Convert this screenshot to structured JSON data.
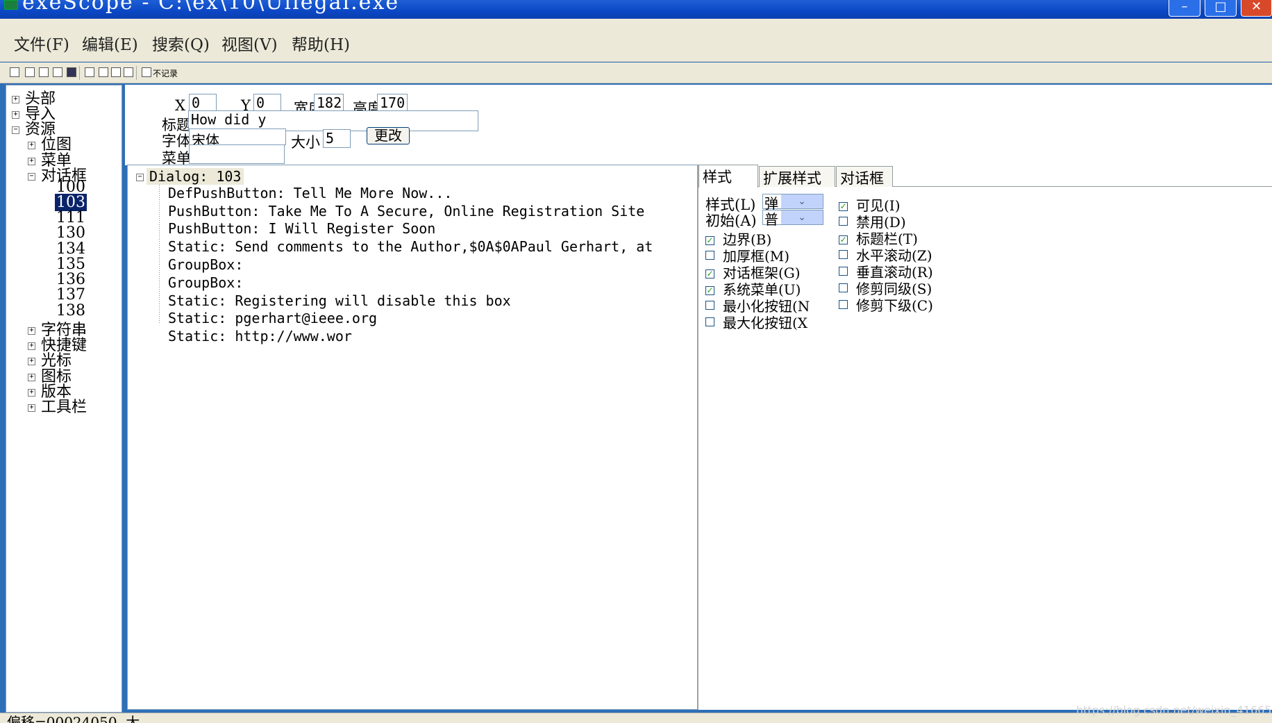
{
  "window": {
    "title": "exeScope - C:\\ex\\10\\Ullegal.exe",
    "minimize": "–",
    "maximize": "□",
    "close": "✕"
  },
  "menu": {
    "items": [
      "文件(F)",
      "编辑(E)",
      "搜索(Q)",
      "视图(V)",
      "帮助(H)"
    ]
  },
  "toolbar": {
    "no_record_label": "不记录"
  },
  "tree": {
    "header": "头部",
    "import": "导入",
    "resources": "资源",
    "bitmap": "位图",
    "menu": "菜单",
    "dialog": "对话框",
    "dialog_ids": [
      "100",
      "103",
      "111",
      "130",
      "134",
      "135",
      "136",
      "137",
      "138"
    ],
    "string": "字符串",
    "accelerator": "快捷键",
    "cursor": "光标",
    "icon": "图标",
    "version": "版本",
    "toolbar": "工具栏"
  },
  "props": {
    "x_label": "X",
    "x_value": "0",
    "y_label": "Y",
    "y_value": "0",
    "width_label": "宽度",
    "width_value": "182",
    "height_label": "高度",
    "height_value": "170",
    "title_label": "标题",
    "title_value": "How did y",
    "font_label": "字体",
    "font_value": "宋体",
    "size_label": "大小",
    "size_value": "5",
    "menu_label": "菜单",
    "menu_value": "",
    "change_button": "更改"
  },
  "dialog_tree": {
    "root": "Dialog: 103",
    "items": [
      "DefPushButton: Tell Me More Now...",
      "PushButton: Take Me To A Secure, Online Registration Site",
      "PushButton: I Will Register Soon",
      "Static: Send comments to the Author,$0A$0APaul Gerhart, at",
      "GroupBox:",
      "GroupBox:",
      "Static: Registering will disable this box",
      "Static: pgerhart@ieee.org",
      "Static: http://www.wor"
    ]
  },
  "style_panel": {
    "tabs": [
      "样式",
      "扩展样式",
      "对话框"
    ],
    "style_label": "样式(L)",
    "style_value": "弹",
    "initial_label": "初始(A)",
    "initial_value": "普",
    "left_checks": [
      {
        "label": "边界(B)",
        "checked": true
      },
      {
        "label": "加厚框(M)",
        "checked": false
      },
      {
        "label": "对话框架(G)",
        "checked": true
      },
      {
        "label": "系统菜单(U)",
        "checked": true
      },
      {
        "label": "最小化按钮(N",
        "checked": false
      },
      {
        "label": "最大化按钮(X",
        "checked": false
      }
    ],
    "right_checks": [
      {
        "label": "可见(I)",
        "checked": true
      },
      {
        "label": "禁用(D)",
        "checked": false
      },
      {
        "label": "标题栏(T)",
        "checked": true
      },
      {
        "label": "水平滚动(Z)",
        "checked": false
      },
      {
        "label": "垂直滚动(R)",
        "checked": false
      },
      {
        "label": "修剪同级(S)",
        "checked": false
      },
      {
        "label": "修剪下级(C)",
        "checked": false
      }
    ]
  },
  "status": {
    "text": "偏移=00024050, 大"
  },
  "watermark": "https://blog.csdn.net/weixin_41665985"
}
